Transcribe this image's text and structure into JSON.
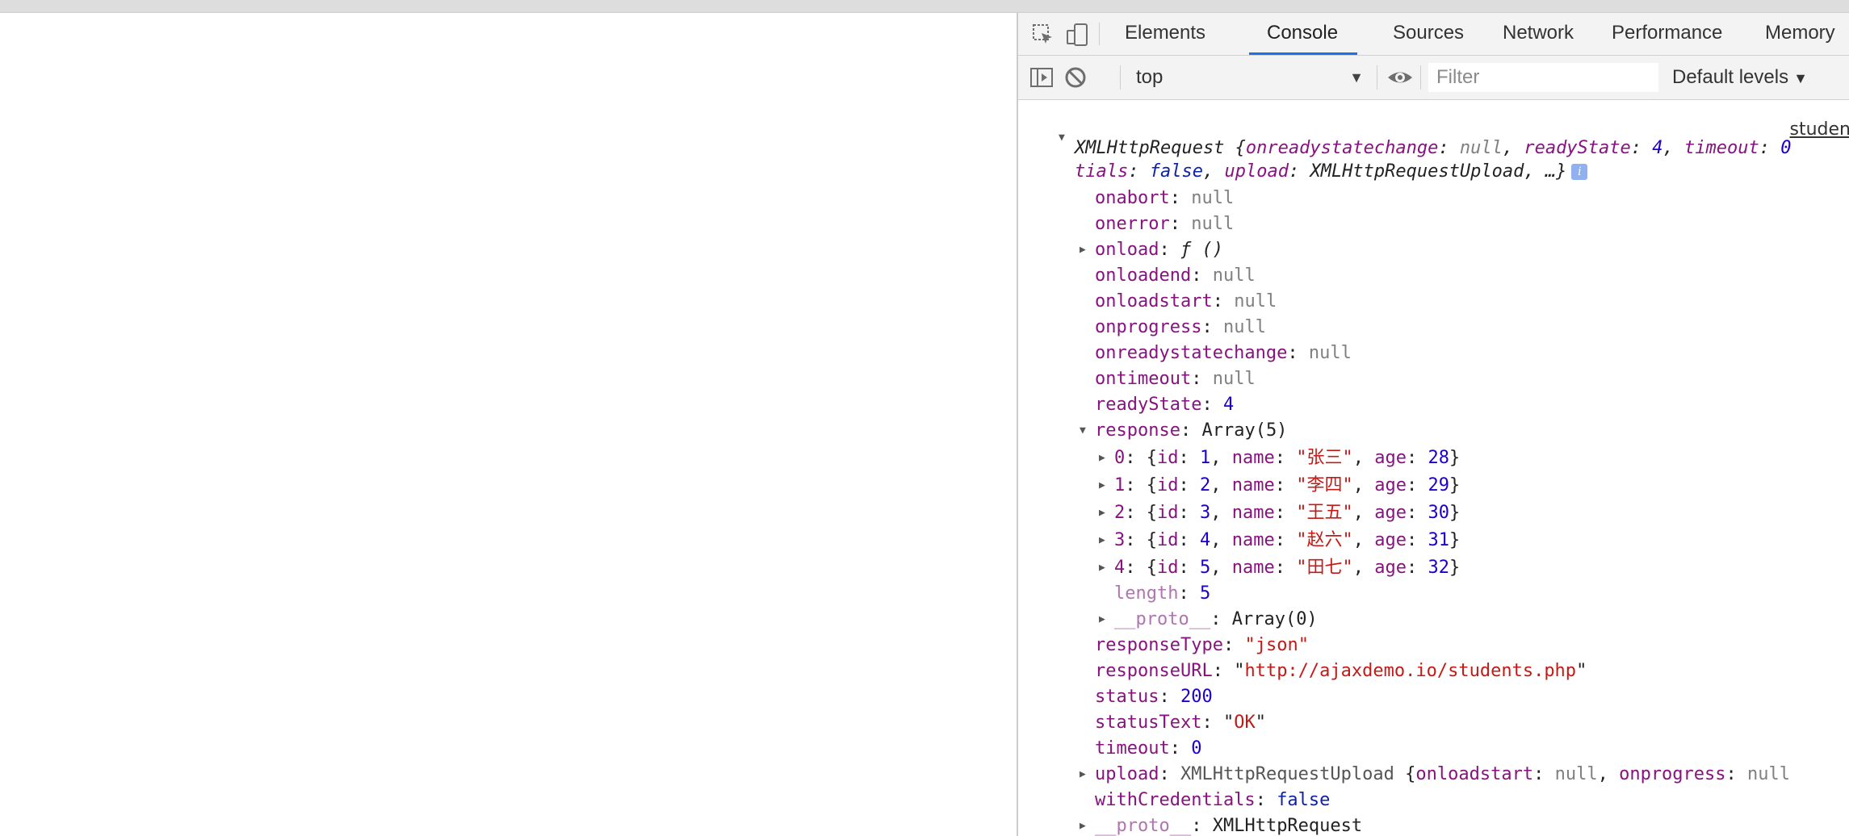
{
  "devtools": {
    "tabs": [
      {
        "label": "Elements",
        "active": false
      },
      {
        "label": "Console",
        "active": true
      },
      {
        "label": "Sources",
        "active": false
      },
      {
        "label": "Network",
        "active": false
      },
      {
        "label": "Performance",
        "active": false
      },
      {
        "label": "Memory",
        "active": false
      }
    ],
    "toolbar": {
      "context": "top",
      "filter_placeholder": "Filter",
      "levels": "Default levels"
    }
  },
  "console": {
    "source_link": "studen",
    "summary": {
      "prefix": "XMLHttpRequest {",
      "k1": "onreadystatechange",
      "v1": "null",
      "k2": "readyState",
      "v2": "4",
      "k3": "timeout",
      "v3": "0",
      "k4_tail": "tials",
      "v4": "false",
      "k5": "upload",
      "v5": "XMLHttpRequestUpload",
      "ellipsis": "…}",
      "info": "i"
    },
    "props": {
      "onabort": {
        "key": "onabort",
        "value": "null"
      },
      "onerror": {
        "key": "onerror",
        "value": "null"
      },
      "onload": {
        "key": "onload",
        "value": "ƒ ()"
      },
      "onloadend": {
        "key": "onloadend",
        "value": "null"
      },
      "onloadstart": {
        "key": "onloadstart",
        "value": "null"
      },
      "onprogress": {
        "key": "onprogress",
        "value": "null"
      },
      "onreadystatechange": {
        "key": "onreadystatechange",
        "value": "null"
      },
      "ontimeout": {
        "key": "ontimeout",
        "value": "null"
      },
      "readyState": {
        "key": "readyState",
        "value": "4"
      },
      "response": {
        "key": "response",
        "value": "Array(5)"
      },
      "length": {
        "key": "length",
        "value": "5"
      },
      "proto_array": {
        "key": "__proto__",
        "value": "Array(0)"
      },
      "responseType": {
        "key": "responseType",
        "value": "json"
      },
      "responseURL": {
        "key": "responseURL",
        "value": "http://ajaxdemo.io/students.php"
      },
      "status": {
        "key": "status",
        "value": "200"
      },
      "statusText": {
        "key": "statusText",
        "value": "OK"
      },
      "timeout": {
        "key": "timeout",
        "value": "0"
      },
      "upload": {
        "key": "upload",
        "value": "XMLHttpRequestUpload",
        "preview_k1": "onloadstart",
        "preview_v1": "null",
        "preview_k2": "onprogress",
        "preview_v2": "null"
      },
      "withCredentials": {
        "key": "withCredentials",
        "value": "false"
      },
      "proto": {
        "key": "__proto__",
        "value": "XMLHttpRequest"
      }
    },
    "items": [
      {
        "index": "0",
        "id": "1",
        "name": "张三",
        "age": "28"
      },
      {
        "index": "1",
        "id": "2",
        "name": "李四",
        "age": "29"
      },
      {
        "index": "2",
        "id": "3",
        "name": "王五",
        "age": "30"
      },
      {
        "index": "3",
        "id": "4",
        "name": "赵六",
        "age": "31"
      },
      {
        "index": "4",
        "id": "5",
        "name": "田七",
        "age": "32"
      }
    ]
  }
}
